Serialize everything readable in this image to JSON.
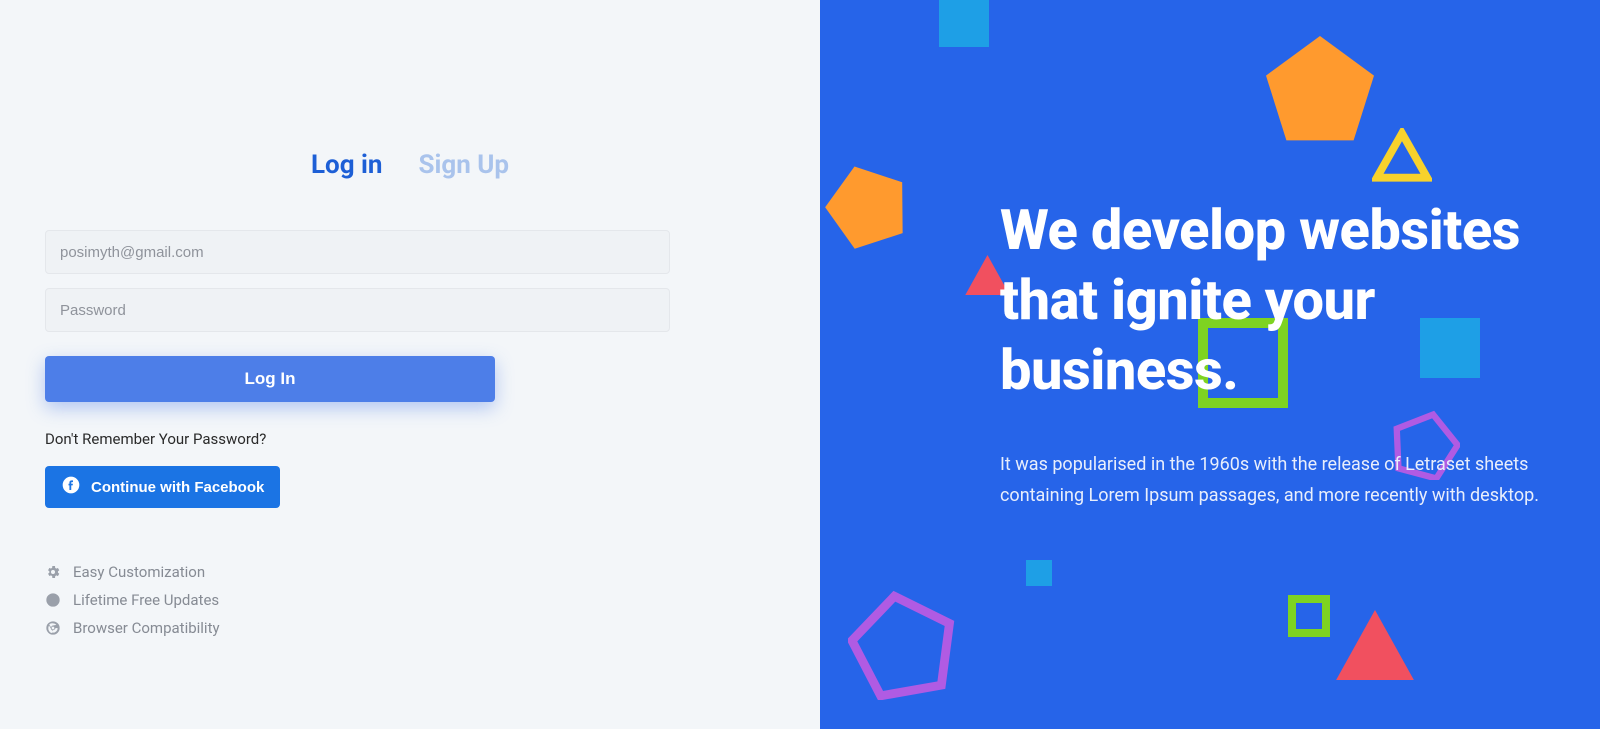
{
  "tabs": {
    "login": "Log in",
    "signup": "Sign Up"
  },
  "form": {
    "email_placeholder": "posimyth@gmail.com",
    "password_placeholder": "Password",
    "login_btn": "Log In",
    "forgot": "Don't Remember Your Password?",
    "fb_btn": "Continue with Facebook"
  },
  "features": {
    "items": [
      "Easy Customization",
      "Lifetime Free Updates",
      "Browser Compatibility"
    ]
  },
  "hero": {
    "title": "We develop websites that ignite your business.",
    "body": "It was popularised in the 1960s with the release of Letraset sheets containing Lorem Ipsum passages, and more recently with desktop."
  }
}
